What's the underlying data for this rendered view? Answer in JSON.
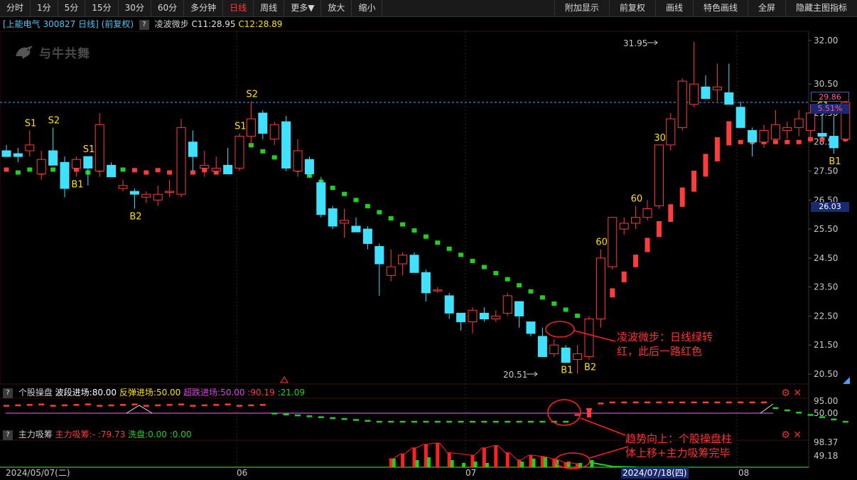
{
  "toolbar": {
    "periods": [
      "分时",
      "1分",
      "5分",
      "15分",
      "30分",
      "60分",
      "多分钟",
      "日线",
      "周线",
      "更多▼",
      "放大",
      "缩小"
    ],
    "active": "日线",
    "right": [
      "附加显示",
      "前复权",
      "画线",
      "特色画线",
      "全屏",
      "隐藏主图指标"
    ]
  },
  "stock": {
    "bracket_title": "[上能电气 300827 日线]",
    "fq": "(前复权)",
    "indicator": "凌波微步",
    "c1": "C11:28.95",
    "c2": "C12:28.89"
  },
  "logo": "与牛共舞",
  "price_axis": [
    "32.00",
    "30.50",
    "29.50",
    "28.50",
    "27.50",
    "26.50",
    "25.50",
    "24.50",
    "23.50",
    "22.50",
    "21.50",
    "20.50"
  ],
  "badges": {
    "price": "29.86",
    "pct": "5.51%",
    "level": "26.03"
  },
  "peak": "31.95",
  "trough": "20.51",
  "annotations": {
    "note1_line1": "凌波微步：日线绿转",
    "note1_line2": "红，此后一路红色",
    "note2_line1": "趋势向上：个股操盘柱",
    "note2_line2": "体上移+主力吸筹完毕"
  },
  "panel1": {
    "name": "个股操盘",
    "item1": "波段进场:80.00",
    "item2": "反弹进场:50.00",
    "item3": "超跌进场:50.00",
    "item4": ":90.19",
    "item5": ":21.09",
    "axis": [
      "95.00",
      "50.00"
    ]
  },
  "panel2": {
    "name": "主力吸筹",
    "item1": "主力吸筹:-",
    "item2": ":79.73",
    "item3": "洗盘:0.00",
    "item4": ":0.00",
    "axis": [
      "98.37",
      "49.18"
    ]
  },
  "dates": {
    "start": "2024/05/07(二)",
    "m06": "06",
    "m07": "07",
    "cursor": "2024/07/18(四)",
    "m08": "08"
  },
  "chart_data": {
    "type": "candlestick",
    "ohlc": [
      [
        28.2,
        28.4,
        28.0,
        28.0
      ],
      [
        28.1,
        28.3,
        27.8,
        28.0
      ],
      [
        28.2,
        28.9,
        28.0,
        28.4
      ],
      [
        27.4,
        28.2,
        27.2,
        27.9
      ],
      [
        28.2,
        29.0,
        27.9,
        27.7
      ],
      [
        27.8,
        28.0,
        26.6,
        26.9
      ],
      [
        27.6,
        28.0,
        27.3,
        27.9
      ],
      [
        28.0,
        28.0,
        27.0,
        27.6
      ],
      [
        27.5,
        29.5,
        27.3,
        29.1
      ],
      [
        27.7,
        27.8,
        27.3,
        27.3
      ],
      [
        26.9,
        27.2,
        26.8,
        27.0
      ],
      [
        26.8,
        26.9,
        26.2,
        26.7
      ],
      [
        26.6,
        26.8,
        26.4,
        26.7
      ],
      [
        26.5,
        27.0,
        26.3,
        26.7
      ],
      [
        26.8,
        27.2,
        26.6,
        26.8
      ],
      [
        26.7,
        29.3,
        26.6,
        29.0
      ],
      [
        28.5,
        28.9,
        27.5,
        28.0
      ],
      [
        27.6,
        28.2,
        27.3,
        27.7
      ],
      [
        27.5,
        28.0,
        27.4,
        27.6
      ],
      [
        27.7,
        28.3,
        27.5,
        27.4
      ],
      [
        27.6,
        28.8,
        27.5,
        28.7
      ],
      [
        28.7,
        29.9,
        28.4,
        29.3
      ],
      [
        29.5,
        29.6,
        28.6,
        28.8
      ],
      [
        28.6,
        29.2,
        28.4,
        29.1
      ],
      [
        29.2,
        29.4,
        27.5,
        27.6
      ],
      [
        27.5,
        28.6,
        27.3,
        28.2
      ],
      [
        27.9,
        28.0,
        27.3,
        27.4
      ],
      [
        27.1,
        27.3,
        25.9,
        26.0
      ],
      [
        26.2,
        26.3,
        25.5,
        25.6
      ],
      [
        25.7,
        26.2,
        25.2,
        25.8
      ],
      [
        25.6,
        25.9,
        25.4,
        25.4
      ],
      [
        25.5,
        25.6,
        24.8,
        25.0
      ],
      [
        24.9,
        25.0,
        23.2,
        24.3
      ],
      [
        23.9,
        24.8,
        23.7,
        24.2
      ],
      [
        24.3,
        24.7,
        23.9,
        24.6
      ],
      [
        24.6,
        24.7,
        24.0,
        24.0
      ],
      [
        24.0,
        24.1,
        23.0,
        23.3
      ],
      [
        23.4,
        23.5,
        23.3,
        23.4
      ],
      [
        23.2,
        23.3,
        22.4,
        22.6
      ],
      [
        22.6,
        22.6,
        22.0,
        22.3
      ],
      [
        22.3,
        22.8,
        21.9,
        22.7
      ],
      [
        22.6,
        22.8,
        22.3,
        22.4
      ],
      [
        22.4,
        22.7,
        22.3,
        22.5
      ],
      [
        22.6,
        23.3,
        22.5,
        23.2
      ],
      [
        23.0,
        23.0,
        22.1,
        22.5
      ],
      [
        22.3,
        22.3,
        21.8,
        21.9
      ],
      [
        21.8,
        22.1,
        21.1,
        21.1
      ],
      [
        21.2,
        21.7,
        21.1,
        21.5
      ],
      [
        21.4,
        21.5,
        20.9,
        20.9
      ],
      [
        21.0,
        21.5,
        20.51,
        21.2
      ],
      [
        21.1,
        22.5,
        21.0,
        22.4
      ],
      [
        22.4,
        24.8,
        22.1,
        24.5
      ],
      [
        24.2,
        25.9,
        24.1,
        25.9
      ],
      [
        25.5,
        25.9,
        25.3,
        25.7
      ],
      [
        25.7,
        26.3,
        25.5,
        25.9
      ],
      [
        25.9,
        26.5,
        25.8,
        26.2
      ],
      [
        26.3,
        28.4,
        26.2,
        28.4
      ],
      [
        28.4,
        29.5,
        28.2,
        29.3
      ],
      [
        29.0,
        30.7,
        28.9,
        30.6
      ],
      [
        29.8,
        31.95,
        29.7,
        30.5
      ],
      [
        30.4,
        30.8,
        30.0,
        30.0
      ],
      [
        30.3,
        31.2,
        29.9,
        30.4
      ],
      [
        30.2,
        31.2,
        29.8,
        29.8
      ],
      [
        29.7,
        29.9,
        29.0,
        29.0
      ],
      [
        28.9,
        29.0,
        28.0,
        28.5
      ],
      [
        28.5,
        29.1,
        28.3,
        28.9
      ],
      [
        28.6,
        29.6,
        28.5,
        29.1
      ],
      [
        28.9,
        29.2,
        28.6,
        29.0
      ],
      [
        29.0,
        29.6,
        28.7,
        29.3
      ],
      [
        28.9,
        29.8,
        28.6,
        29.5
      ],
      [
        28.8,
        29.5,
        28.6,
        28.7
      ],
      [
        28.7,
        29.4,
        28.1,
        28.3
      ],
      [
        28.6,
        29.9,
        28.5,
        29.86
      ]
    ],
    "signals": [
      {
        "i": 2,
        "t": "S1"
      },
      {
        "i": 4,
        "t": "S2"
      },
      {
        "i": 6,
        "t": "B1"
      },
      {
        "i": 7,
        "t": "S1"
      },
      {
        "i": 11,
        "t": "B2"
      },
      {
        "i": 20,
        "t": "S1"
      },
      {
        "i": 21,
        "t": "S2"
      },
      {
        "i": 48,
        "t": "B1"
      },
      {
        "i": 50,
        "t": "B2"
      },
      {
        "i": 51,
        "t": "60"
      },
      {
        "i": 54,
        "t": "60"
      },
      {
        "i": 56,
        "t": "30"
      },
      {
        "i": 70,
        "t": "S1"
      },
      {
        "i": 71,
        "t": "B1"
      }
    ]
  },
  "colors": {
    "bg": "#000000",
    "up": "#ff3c3c",
    "down": "#40e0ff",
    "green": "#20d020",
    "yellow": "#ffe000",
    "magenta": "#e040e0"
  }
}
